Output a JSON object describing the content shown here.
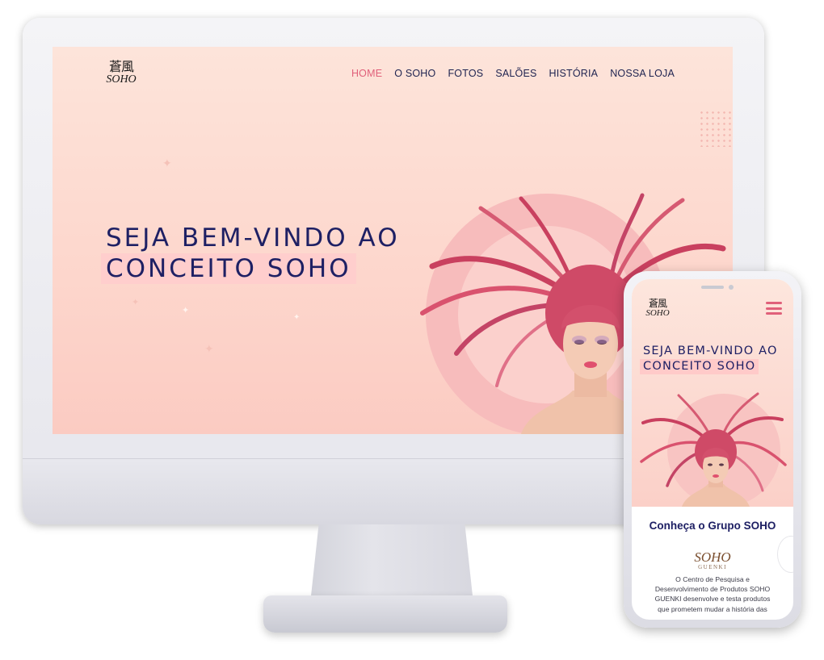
{
  "desktop": {
    "logo": {
      "mark": "蒼風",
      "text": "SOHO"
    },
    "nav": [
      {
        "label": "HOME",
        "active": true
      },
      {
        "label": "O SOHO",
        "active": false
      },
      {
        "label": "FOTOS",
        "active": false
      },
      {
        "label": "SALÕES",
        "active": false
      },
      {
        "label": "HISTÓRIA",
        "active": false
      },
      {
        "label": "NOSSA LOJA",
        "active": false
      }
    ],
    "hero": {
      "line1": "SEJA BEM-VINDO AO",
      "line2": "CONCEITO SOHO"
    }
  },
  "mobile": {
    "logo": {
      "mark": "蒼風",
      "text": "SOHO"
    },
    "hero": {
      "line1": "SEJA BEM-VINDO AO",
      "line2": "CONCEITO SOHO"
    },
    "section_title": "Conheça o Grupo SOHO",
    "brand": {
      "name": "SOHO",
      "sub": "GUENKI"
    },
    "body": "O Centro de Pesquisa e Desenvolvimento de Produtos SOHO GUENKI desenvolve e testa produtos que prometem mudar a história das"
  },
  "colors": {
    "accent": "#e0607a",
    "navy": "#1e2064",
    "hero_bg": "#fdd6cc"
  }
}
